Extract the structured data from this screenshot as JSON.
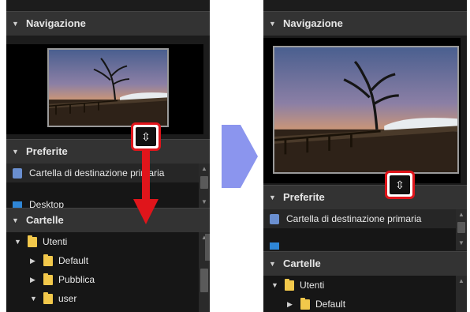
{
  "left": {
    "nav_header": "Navigazione",
    "fav_header": "Preferite",
    "folders_header": "Cartelle",
    "favorites": [
      {
        "label": "Cartella di destinazione primaria",
        "icon": "destination-folder-icon"
      },
      {
        "label": "Desktop",
        "icon": "desktop-icon"
      }
    ],
    "folders": [
      {
        "label": "Utenti",
        "expander": "▼"
      },
      {
        "label": "Default",
        "expander": "▶"
      },
      {
        "label": "Pubblica",
        "expander": "▶"
      },
      {
        "label": "user",
        "expander": "▼"
      }
    ]
  },
  "right": {
    "nav_header": "Navigazione",
    "fav_header": "Preferite",
    "folders_header": "Cartelle",
    "favorites": [
      {
        "label": "Cartella di destinazione primaria",
        "icon": "destination-folder-icon"
      }
    ],
    "folders": [
      {
        "label": "Utenti",
        "expander": "▼"
      },
      {
        "label": "Default",
        "expander": "▶"
      }
    ]
  },
  "icons": {
    "resize_grip": "resize-vertical-icon",
    "flow_arrow": "arrow-right-icon",
    "drag_arrow": "arrow-down-icon"
  },
  "colors": {
    "highlight": "#e0151b",
    "flow_arrow": "#8b95ee",
    "folder": "#f2c84b"
  }
}
